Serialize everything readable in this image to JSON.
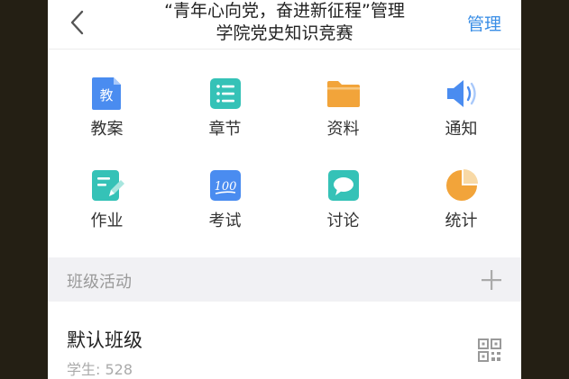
{
  "header": {
    "title_line1": "“青年心向党，奋进新征程”管理",
    "title_line2": "学院党史知识竞赛",
    "manage_label": "管理",
    "back_icon": "chevron-left-icon"
  },
  "features": [
    {
      "label": "教案",
      "icon": "lesson-plan-icon",
      "icon_text": "教",
      "color": "#4a8cf0"
    },
    {
      "label": "章节",
      "icon": "chapter-list-icon",
      "color": "#35c2b7"
    },
    {
      "label": "资料",
      "icon": "folder-icon",
      "color": "#f2a43a"
    },
    {
      "label": "通知",
      "icon": "speaker-icon",
      "color": "#4a8cf0"
    },
    {
      "label": "作业",
      "icon": "homework-edit-icon",
      "color": "#35c2b7"
    },
    {
      "label": "考试",
      "icon": "exam-score-icon",
      "icon_text": "100",
      "color": "#4a8cf0"
    },
    {
      "label": "讨论",
      "icon": "discussion-bubble-icon",
      "color": "#35c2b7"
    },
    {
      "label": "统计",
      "icon": "pie-chart-icon",
      "color": "#f2a43a"
    }
  ],
  "section": {
    "title": "班级活动",
    "add_icon": "plus-icon"
  },
  "class": {
    "name": "默认班级",
    "students": "学生: 528",
    "qr_icon": "qr-code-icon"
  }
}
